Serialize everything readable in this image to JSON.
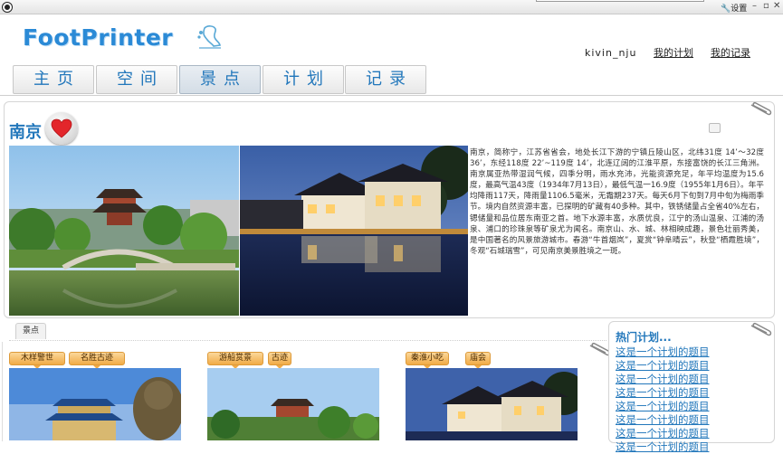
{
  "window": {
    "settings_label": "设置"
  },
  "brand": {
    "logo_text": "FootPrinter"
  },
  "user": {
    "name": "kivin_nju",
    "my_plans": "我的计划",
    "my_records": "我的记录"
  },
  "nav": {
    "tabs": [
      {
        "label": "主页"
      },
      {
        "label": "空间"
      },
      {
        "label": "景点",
        "active": true
      },
      {
        "label": "计划"
      },
      {
        "label": "记录"
      }
    ]
  },
  "city": {
    "name": "南京",
    "description": "南京，简称宁，江苏省省会，地处长江下游的宁镇丘陵山区，北纬31度 14’～32度36’，东经118度 22’~119度 14’，北连辽阔的江淮平原，东接富饶的长江三角洲。南京属亚热带湿润气候，四季分明，雨水充沛，光能资源充足，年平均温度为15.6度，最高气温43度（1934年7月13日），最低气温一16.9度（1955年1月6日）。年平均降雨117天，降雨量1106.5毫米，无霜期237天。每天6月下旬到7月中旬为梅雨季节。境内自然资源丰富，已探明的矿藏有40多种。其中，铁锈储量占全省40%左右，锶储量和品位居东南亚之首。地下水源丰富，水质优良，江宁的汤山温泉、江浦的汤泉、浦口的珍珠泉等矿泉尤为闻名。南京山、水、城、林相映成趣，景色壮丽秀美，是中国著名的风景旅游城市。春游“牛首烟岚”，夏赏“钟阜晴云”，秋登“栖霞胜境”，冬观“石城瑞雪”，可见南京美景胜境之一斑。"
  },
  "section_tab": "景点",
  "attractions": [
    {
      "tags": [
        "木样警世",
        "名胜古迹"
      ]
    },
    {
      "tags": [
        "游船赏景",
        "古迹"
      ]
    },
    {
      "tags": [
        "秦淮小吃",
        "庙会"
      ]
    }
  ],
  "plans": {
    "title": "热门计划...",
    "items": [
      "这是一个计划的题目",
      "这是一个计划的题目",
      "这是一个计划的题目",
      "这是一个计划的题目",
      "这是一个计划的题目",
      "这是一个计划的题目",
      "这是一个计划的题目",
      "这是一个计划的题目"
    ]
  },
  "colors": {
    "accent": "#2277bb",
    "tag": "#f1ab46",
    "heart": "#e3262b"
  }
}
